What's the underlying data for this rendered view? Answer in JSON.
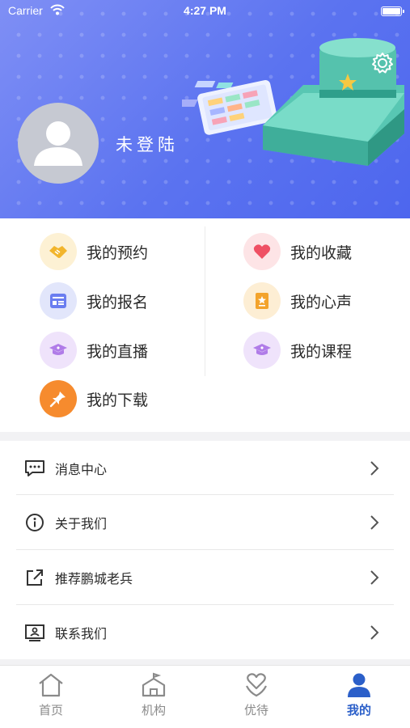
{
  "status_bar": {
    "carrier": "Carrier",
    "time": "4:27 PM"
  },
  "profile": {
    "login_status": "未登陆"
  },
  "grid": [
    {
      "label": "我的预约",
      "icon": "handshake-icon",
      "bg": "#fdf1d4",
      "color": "#f2b52c"
    },
    {
      "label": "我的收藏",
      "icon": "heart-icon",
      "bg": "#fde4e6",
      "color": "#ef5064"
    },
    {
      "label": "我的报名",
      "icon": "form-icon",
      "bg": "#e2e6fb",
      "color": "#6a7df0"
    },
    {
      "label": "我的心声",
      "icon": "note-icon",
      "bg": "#fdeed4",
      "color": "#f3a32c"
    },
    {
      "label": "我的直播",
      "icon": "graduation-cap-icon",
      "bg": "#efe3fb",
      "color": "#b07ce8"
    },
    {
      "label": "我的课程",
      "icon": "graduation-cap-icon",
      "bg": "#efe3fb",
      "color": "#b07ce8"
    },
    {
      "label": "我的下载",
      "icon": "pin-icon",
      "bg": "#f68b2e",
      "color": "#ffffff"
    }
  ],
  "menu": [
    {
      "label": "消息中心",
      "icon": "message-icon"
    },
    {
      "label": "关于我们",
      "icon": "info-icon"
    },
    {
      "label": "推荐鹏城老兵",
      "icon": "share-icon"
    },
    {
      "label": "联系我们",
      "icon": "contact-card-icon"
    }
  ],
  "tabs": [
    {
      "label": "首页",
      "icon": "home-icon",
      "active": false
    },
    {
      "label": "机构",
      "icon": "institution-icon",
      "active": false
    },
    {
      "label": "优待",
      "icon": "care-icon",
      "active": false
    },
    {
      "label": "我的",
      "icon": "user-icon",
      "active": true
    }
  ],
  "colors": {
    "accent": "#2b5fc9",
    "header": "#5b73f0"
  }
}
